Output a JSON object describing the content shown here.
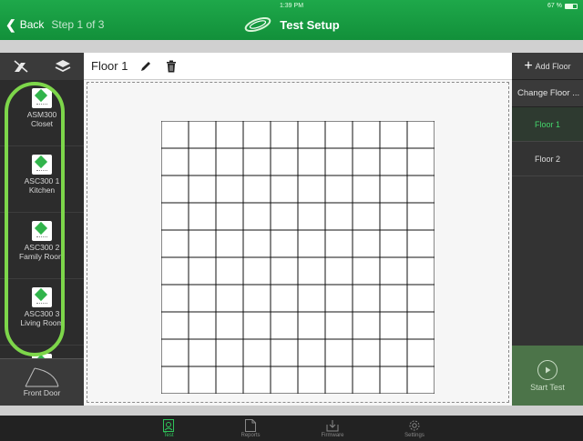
{
  "status": {
    "time": "1:39 PM",
    "battery": "67 %",
    "battery_level": 0.67
  },
  "nav": {
    "back_label": "Back",
    "step": "Step 1 of 3",
    "title": "Test Setup"
  },
  "toolbar": {
    "left_icons": [
      "eraser-icon",
      "layers-icon"
    ]
  },
  "devices": [
    {
      "line1": "ASM300",
      "line2": "Closet"
    },
    {
      "line1": "ASC300 1",
      "line2": "Kitchen"
    },
    {
      "line1": "ASC300 2",
      "line2": "Family Room"
    },
    {
      "line1": "ASC300 3",
      "line2": "Living Room"
    }
  ],
  "front_door": {
    "label": "Front Door"
  },
  "floor_plan": {
    "floor_name": "Floor 1",
    "grid_rows": 10,
    "grid_cols": 10
  },
  "right_panel": {
    "add_floor": "Add Floor",
    "change_floor": "Change Floor ...",
    "floors": [
      "Floor 1",
      "Floor 2"
    ],
    "selected_floor": "Floor 1",
    "start_test": "Start Test"
  },
  "tabs": [
    {
      "label": "Test",
      "icon": "test-icon",
      "active": true
    },
    {
      "label": "Reports",
      "icon": "reports-icon",
      "active": false
    },
    {
      "label": "Firmware",
      "icon": "firmware-icon",
      "active": false
    },
    {
      "label": "Settings",
      "icon": "settings-icon",
      "active": false
    }
  ],
  "colors": {
    "accent": "#1ea84a",
    "highlight_oval": "#7dd64a",
    "active_floor": "#44d66b",
    "start_test_bg": "#4c7449"
  }
}
